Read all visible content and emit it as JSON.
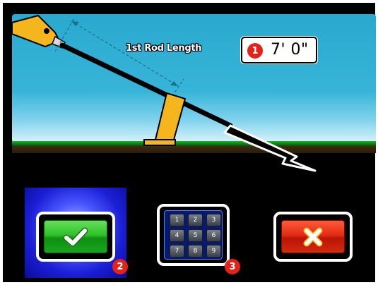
{
  "measurement": {
    "label": "1st Rod Length",
    "step_number": "1",
    "value": "7' 0\""
  },
  "buttons": {
    "confirm": {
      "badge": "2",
      "icon": "checkmark-icon",
      "color": "#2ec12a"
    },
    "keypad": {
      "badge": "3",
      "icon": "keypad-icon",
      "keys": [
        "1",
        "2",
        "3",
        "4",
        "5",
        "6",
        "7",
        "8",
        "9"
      ]
    },
    "cancel": {
      "icon": "x-icon",
      "color": "#e32c12"
    }
  },
  "colors": {
    "sky": "#37b4d8",
    "ground": "#16b71f",
    "machine": "#f5b51c",
    "badge": "#e2231a",
    "selected_glow": "#1b1fd6"
  }
}
